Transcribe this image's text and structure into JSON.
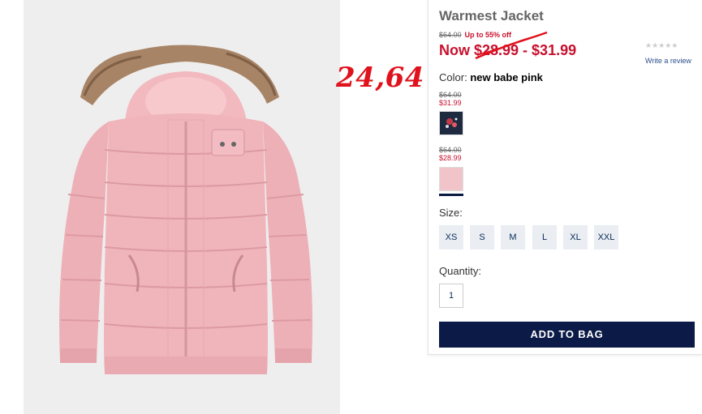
{
  "product": {
    "title": "Warmest Jacket",
    "original_price": "$64.00",
    "promo": "Up to 55% off",
    "now_price": "Now $28.99 - $31.99",
    "rating_stars": "★★★★★",
    "review_link": "Write a review"
  },
  "annotation": {
    "text": "24,64",
    "color": "#e0121c"
  },
  "color": {
    "label": "Color:",
    "selected": "new babe pink",
    "swatches": [
      {
        "old_price": "$64.00",
        "new_price": "$31.99",
        "name": "navy-floral",
        "color": "#1e2a40"
      },
      {
        "old_price": "$64.00",
        "new_price": "$28.99",
        "name": "new babe pink",
        "color": "#f0c4c8",
        "selected": true
      }
    ]
  },
  "size": {
    "label": "Size:",
    "options": [
      "XS",
      "S",
      "M",
      "L",
      "XL",
      "XXL"
    ]
  },
  "quantity": {
    "label": "Quantity:",
    "value": "1"
  },
  "cta": {
    "label": "ADD TO BAG"
  },
  "colors": {
    "sale_red": "#c8102e",
    "navy": "#0b1a46",
    "jacket_pink": "#f0b8be"
  }
}
